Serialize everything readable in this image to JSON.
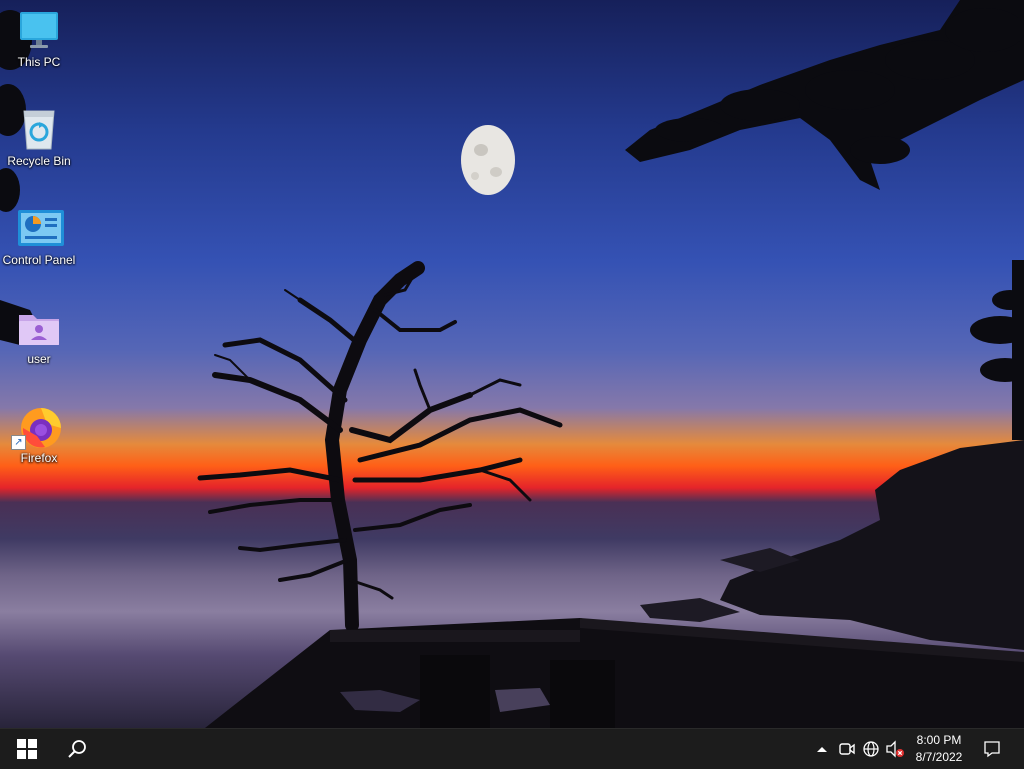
{
  "desktop": {
    "icons": [
      {
        "label": "This PC",
        "icon": "monitor-icon"
      },
      {
        "label": "Recycle Bin",
        "icon": "recycle-bin-icon"
      },
      {
        "label": "Control Panel",
        "icon": "control-panel-icon"
      },
      {
        "label": "user",
        "icon": "user-folder-icon"
      },
      {
        "label": "Firefox",
        "icon": "firefox-icon"
      }
    ]
  },
  "taskbar": {
    "start_icon": "windows-logo-icon",
    "search_icon": "search-icon",
    "tray": {
      "icons": [
        "chevron-up-icon",
        "meet-now-icon",
        "network-globe-icon",
        "volume-muted-icon"
      ]
    },
    "clock": {
      "time": "8:00 PM",
      "date": "8/7/2022"
    },
    "notification_icon": "notification-icon"
  },
  "colors": {
    "taskbar_bg": "#1c1c1c",
    "sky_top": "#16205a",
    "sunset_orange": "#ff5f17",
    "sunset_red": "#e5242a"
  }
}
